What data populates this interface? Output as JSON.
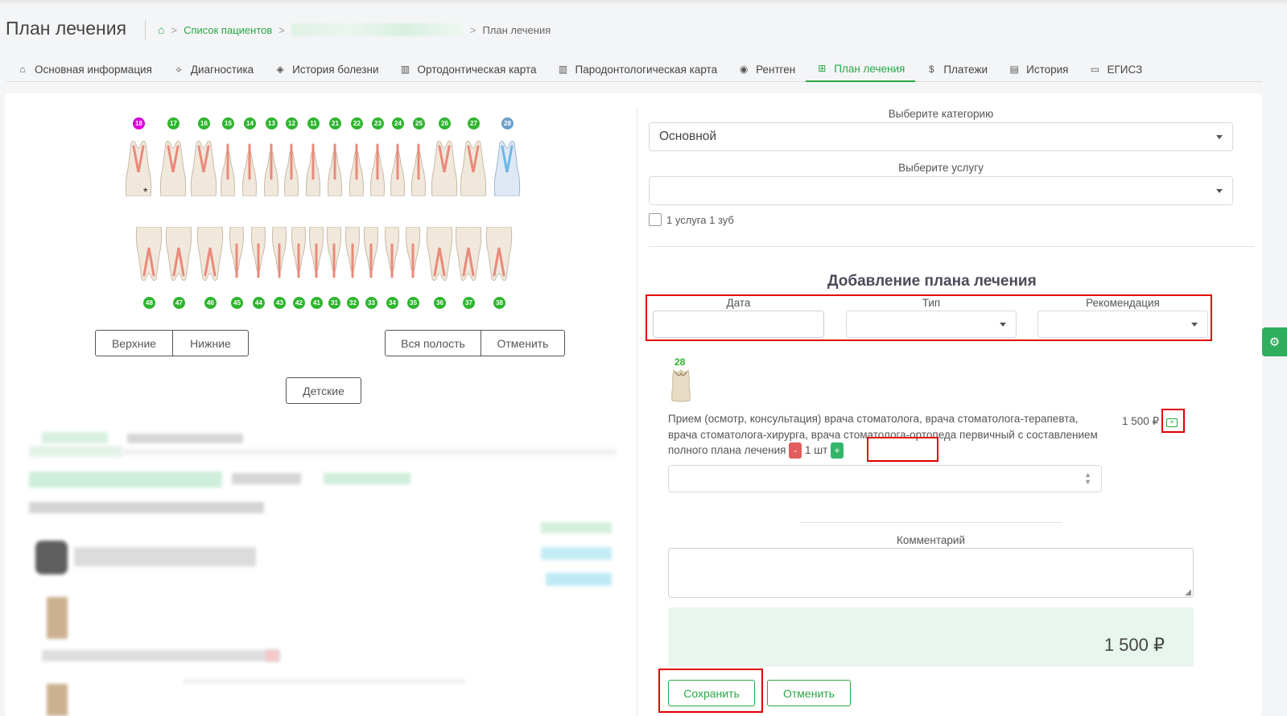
{
  "header": {
    "title": "План лечения",
    "breadcrumb": {
      "patients_link": "Список пациентов",
      "current": "План лечения",
      "separator": ">"
    }
  },
  "tabs": [
    {
      "label": "Основная информация",
      "icon": "home-icon"
    },
    {
      "label": "Диагностика",
      "icon": "pulse-icon"
    },
    {
      "label": "История болезни",
      "icon": "tag-icon"
    },
    {
      "label": "Ортодонтическая карта",
      "icon": "map-icon"
    },
    {
      "label": "Пародонтологическая карта",
      "icon": "map-icon"
    },
    {
      "label": "Рентген",
      "icon": "radio-icon"
    },
    {
      "label": "План лечения",
      "icon": "file-plus-icon",
      "active": true
    },
    {
      "label": "Платежи",
      "icon": "dollar-icon"
    },
    {
      "label": "История",
      "icon": "file-icon"
    },
    {
      "label": "ЕГИСЗ",
      "icon": "clipboard-icon"
    }
  ],
  "dental_chart": {
    "upper_numbers": [
      "18",
      "17",
      "16",
      "15",
      "14",
      "13",
      "12",
      "11",
      "21",
      "22",
      "23",
      "24",
      "25",
      "26",
      "27",
      "28"
    ],
    "lower_numbers": [
      "48",
      "47",
      "46",
      "45",
      "44",
      "43",
      "42",
      "41",
      "31",
      "32",
      "33",
      "34",
      "35",
      "36",
      "37",
      "38"
    ],
    "upper_marker": "*",
    "buttons": {
      "upper": "Верхние",
      "lower": "Нижние",
      "all": "Вся полость",
      "cancel": "Отменить",
      "children": "Детские"
    }
  },
  "form": {
    "category_label": "Выберите категорию",
    "category_value": "Основной",
    "service_label": "Выберите услугу",
    "service_value": "",
    "checkbox_label": "1 услуга 1 зуб",
    "section_title": "Добавление плана лечения",
    "date_label": "Дата",
    "type_label": "Тип",
    "recommendation_label": "Рекомендация",
    "selected_tooth": "28",
    "service_text": "Прием (осмотр, консультация) врача стоматолога, врача стоматолога-терапевта, врача стоматолога-хирурга, врача стоматолога-ортопеда первичный с составлением полного плана лечения",
    "price": "1 500 ₽",
    "qty_minus": "-",
    "qty": "1 шт",
    "qty_plus": "+",
    "comment_label": "Комментарий",
    "total": "1 500 ₽",
    "save": "Сохранить",
    "cancel": "Отменить"
  },
  "colors": {
    "accent": "#28a745",
    "highlight_box": "#e00000",
    "total_bg": "#e8f6ee"
  }
}
